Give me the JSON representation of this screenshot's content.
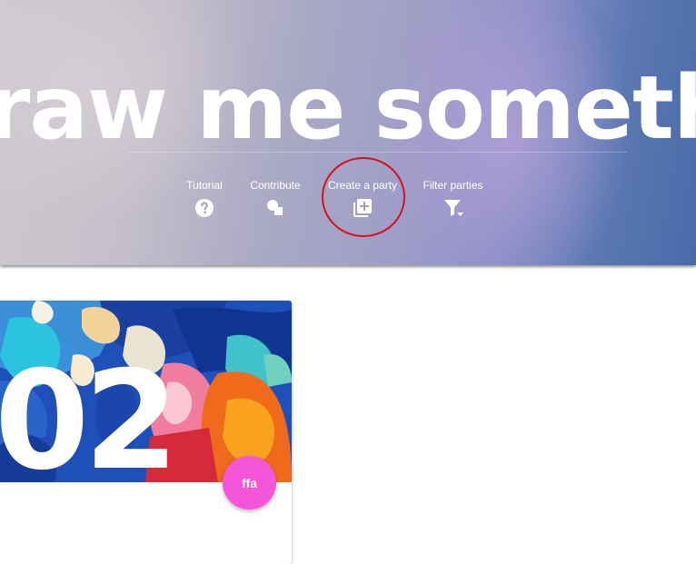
{
  "hero": {
    "title": "raw me somethin"
  },
  "nav": {
    "items": [
      {
        "label": "Tutorial",
        "icon": "help-circle-icon"
      },
      {
        "label": "Contribute",
        "icon": "shapes-icon"
      },
      {
        "label": "Create a party",
        "icon": "library-add-icon"
      },
      {
        "label": "Filter parties",
        "icon": "filter-dropdown-icon"
      }
    ]
  },
  "annotation": {
    "highlighted_item": "Create a party",
    "color": "#d4121f"
  },
  "party_card": {
    "number": "02",
    "avatar_initials": "ffa",
    "avatar_color": "#f556d9"
  },
  "colors": {
    "hero_gradient_start": "#cfc9cd",
    "hero_gradient_end": "#4a6aa8",
    "text": "#ffffff"
  }
}
